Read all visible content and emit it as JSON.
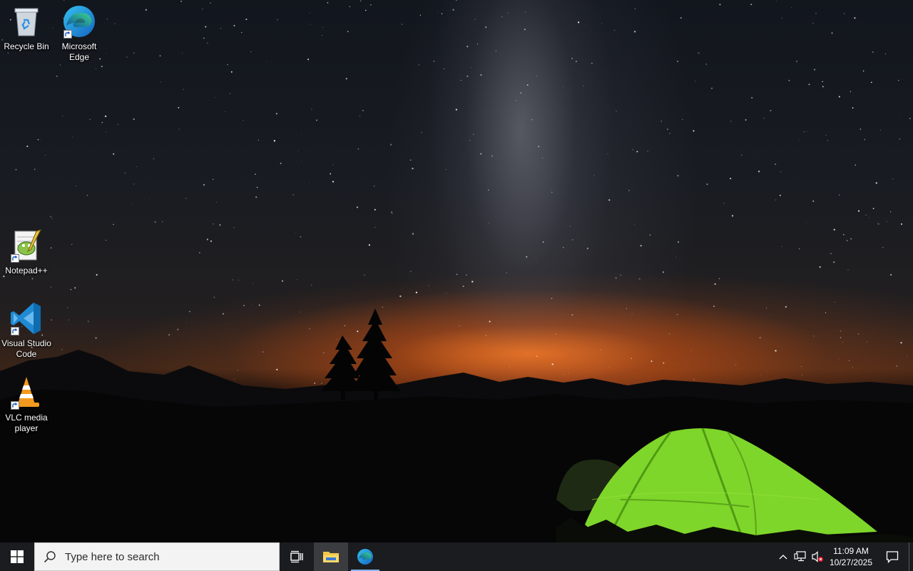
{
  "desktop": {
    "icons": [
      {
        "label": "Recycle Bin"
      },
      {
        "label": "Microsoft Edge"
      },
      {
        "label": "Notepad++"
      },
      {
        "label": "Visual Studio Code"
      },
      {
        "label": "VLC media player"
      }
    ]
  },
  "taskbar": {
    "search_placeholder": "Type here to search",
    "pinned": [
      {
        "icon": "task-view-icon"
      },
      {
        "icon": "file-explorer-icon"
      },
      {
        "icon": "microsoft-edge-icon"
      }
    ],
    "tray": {
      "icons": [
        "chevron-up-icon",
        "network-icon",
        "volume-muted-icon"
      ],
      "time": "11:09 AM",
      "date": "10/27/2025"
    }
  },
  "colors": {
    "taskbar": "#1a1c20",
    "accent": "#8ab4f8",
    "tent": "#7fd62a"
  }
}
